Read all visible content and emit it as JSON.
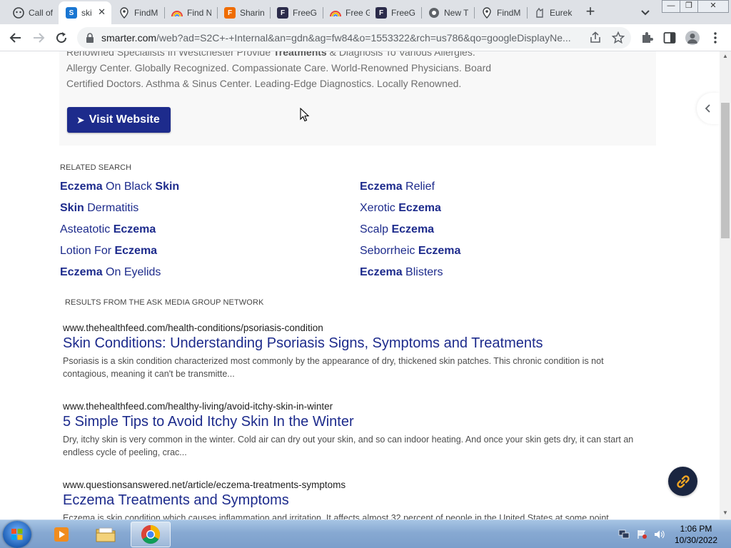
{
  "browser": {
    "tabs": [
      {
        "label": "Call of",
        "icon": "call-of-icon",
        "color": "#1a73e8"
      },
      {
        "label": "ski",
        "icon": "smarter-s-icon",
        "color": "#1976d2",
        "active": true
      },
      {
        "label": "FindM",
        "icon": "map-pin-icon",
        "color": "#fbbc04"
      },
      {
        "label": "Find N",
        "icon": "rainbow-icon",
        "color": "#ea4335"
      },
      {
        "label": "Sharin",
        "icon": "f-logo-icon",
        "color": "#ef6c00"
      },
      {
        "label": "FreeG",
        "icon": "freeg-icon",
        "color": "#2b2b4a"
      },
      {
        "label": "Free G",
        "icon": "rainbow-icon",
        "color": "#ea4335"
      },
      {
        "label": "FreeG",
        "icon": "freeg-icon",
        "color": "#2b2b4a"
      },
      {
        "label": "New T",
        "icon": "chrome-icon",
        "color": "#3c4043"
      },
      {
        "label": "FindM",
        "icon": "map-pin-icon",
        "color": "#fbbc04"
      },
      {
        "label": "Eurek",
        "icon": "eureka-icon",
        "color": "#5f6368"
      }
    ],
    "url_domain": "smarter.com",
    "url_path": "/web?ad=S2C+-+Internal&an=gdn&ag=fw84&o=1553322&rch=us786&qo=googleDisplayNe..."
  },
  "ad": {
    "line1_pre": "Renowned Specialists In Westchester Provide ",
    "line1_bold": "Treatments",
    "line1_post": " & Diagnosis To Various Allergies.",
    "line2": "Allergy Center. Globally Recognized. Compassionate Care. World-Renowned Physicians. Board",
    "line3": "Certified Doctors. Asthma & Sinus Center. Leading-Edge Diagnostics. Locally Renowned.",
    "button_label": "Visit Website"
  },
  "related": {
    "heading": "RELATED SEARCH",
    "left": [
      {
        "a": "Eczema",
        "b": " On Black ",
        "c": "Skin"
      },
      {
        "a": "Skin",
        "b": " Dermatitis",
        "c": ""
      },
      {
        "a": "",
        "b": "Asteatotic ",
        "c": "Eczema"
      },
      {
        "a": "",
        "b": "Lotion For ",
        "c": "Eczema"
      },
      {
        "a": "Eczema",
        "b": " On Eyelids",
        "c": ""
      }
    ],
    "right": [
      {
        "a": "Eczema",
        "b": " Relief",
        "c": ""
      },
      {
        "a": "",
        "b": "Xerotic ",
        "c": "Eczema"
      },
      {
        "a": "",
        "b": "Scalp ",
        "c": "Eczema"
      },
      {
        "a": "",
        "b": "Seborrheic ",
        "c": "Eczema"
      },
      {
        "a": "Eczema",
        "b": " Blisters",
        "c": ""
      }
    ]
  },
  "results": {
    "heading": "RESULTS FROM THE ASK MEDIA GROUP NETWORK",
    "items": [
      {
        "url": "www.thehealthfeed.com/health-conditions/psoriasis-condition",
        "title": "Skin Conditions: Understanding Psoriasis Signs, Symptoms and Treatments",
        "snippet": "Psoriasis is a skin condition characterized most commonly by the appearance of dry, thickened skin patches. This chronic condition is not contagious, meaning it can't be transmitte..."
      },
      {
        "url": "www.thehealthfeed.com/healthy-living/avoid-itchy-skin-in-winter",
        "title": "5 Simple Tips to Avoid Itchy Skin In the Winter",
        "snippet": "Dry, itchy skin is very common in the winter. Cold air can dry out your skin, and so can indoor heating. And once your skin gets dry, it can start an endless cycle of peeling, crac..."
      },
      {
        "url": "www.questionsanswered.net/article/eczema-treatments-symptoms",
        "title": "Eczema Treatments and Symptoms",
        "snippet": "Eczema is skin condition which causes inflammation and irritation. It affects almost 32 percent of people in the United States at some point"
      }
    ]
  },
  "taskbar": {
    "time": "1:06 PM",
    "date": "10/30/2022"
  },
  "colors": {
    "link_blue": "#1d2b8c",
    "button_blue": "#1d2b8c"
  }
}
